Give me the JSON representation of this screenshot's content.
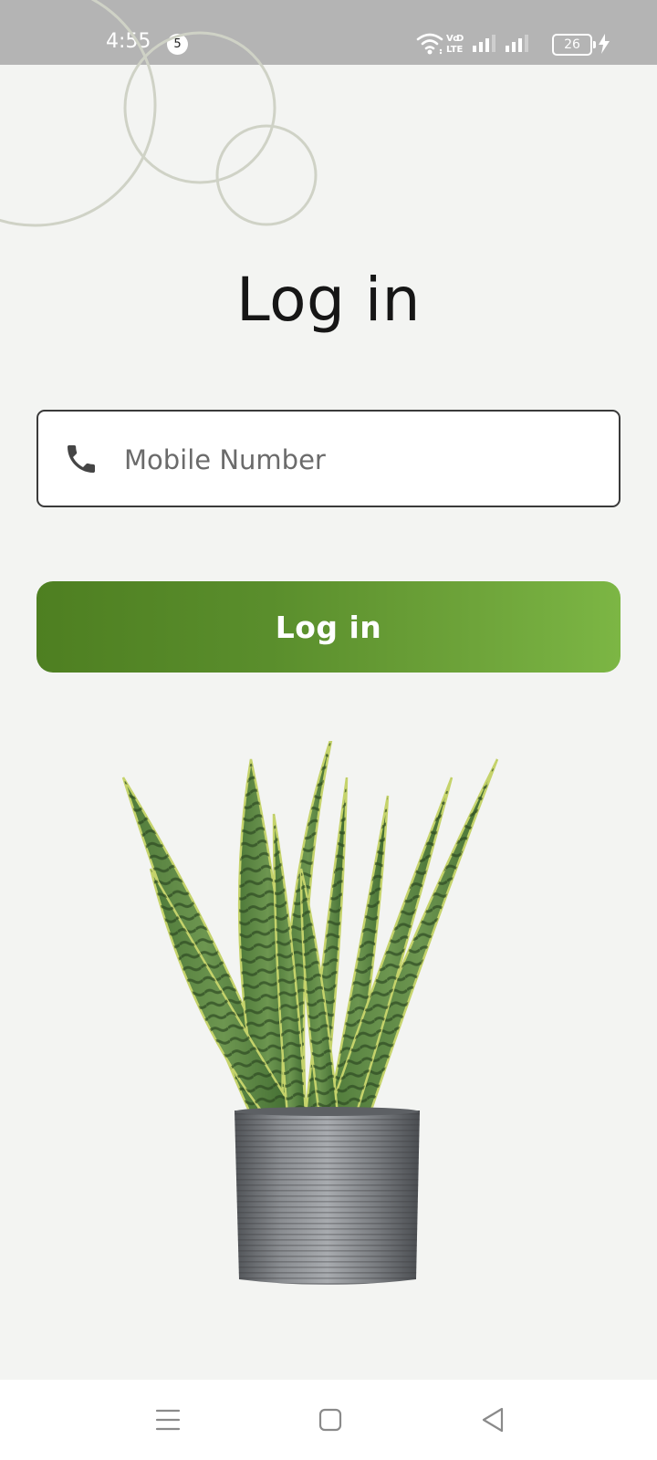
{
  "status_bar": {
    "time": "4:55",
    "notification_count": "5",
    "battery_level": "26",
    "network_label": "VoLTE"
  },
  "login": {
    "title": "Log in",
    "mobile_placeholder": "Mobile Number",
    "mobile_value": "",
    "button_label": "Log in"
  },
  "colors": {
    "background": "#f3f4f2",
    "button_gradient_start": "#4e7f21",
    "button_gradient_end": "#7cb644",
    "title_text": "#161616",
    "status_bar": "#b4b4b4"
  },
  "icons": {
    "phone": "phone-icon",
    "menu": "menu-icon",
    "home": "home-icon",
    "back": "back-icon"
  }
}
